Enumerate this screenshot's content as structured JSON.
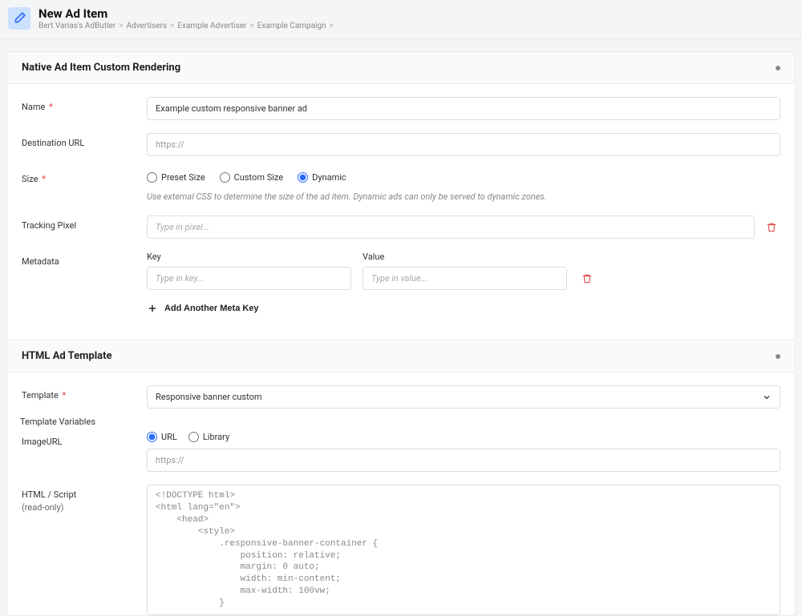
{
  "header": {
    "title": "New Ad Item",
    "breadcrumb": [
      "Bert Varias's AdButler",
      "Advertisers",
      "Example Advertiser",
      "Example Campaign"
    ]
  },
  "section_native": {
    "title": "Native Ad Item Custom Rendering",
    "fields": {
      "name": {
        "label": "Name",
        "value": "Example custom responsive banner ad"
      },
      "destination_url": {
        "label": "Destination URL",
        "placeholder": "https://"
      },
      "size": {
        "label": "Size",
        "options": {
          "preset": "Preset Size",
          "custom": "Custom Size",
          "dynamic": "Dynamic"
        },
        "selected": "dynamic",
        "hint": "Use external CSS to determine the size of the ad item. Dynamic ads can only be served to dynamic zones."
      },
      "tracking_pixel": {
        "label": "Tracking Pixel",
        "placeholder": "Type in pixel..."
      },
      "metadata": {
        "label": "Metadata",
        "key_label": "Key",
        "value_label": "Value",
        "key_placeholder": "Type in key...",
        "value_placeholder": "Type in value...",
        "add_btn": "Add Another Meta Key"
      }
    }
  },
  "section_template": {
    "title": "HTML Ad Template",
    "fields": {
      "template": {
        "label": "Template",
        "value": "Responsive banner custom"
      },
      "template_vars_label": "Template Variables",
      "image_url": {
        "label": "ImageURL",
        "options": {
          "url": "URL",
          "library": "Library"
        },
        "selected": "url",
        "placeholder": "https://"
      },
      "html_script": {
        "label": "HTML / Script",
        "readonly_note": "(read-only)",
        "code": "<!DOCTYPE html>\n<html lang=\"en\">\n    <head>\n        <style>\n            .responsive-banner-container {\n                position: relative;\n                margin: 0 auto;\n                width: min-content;\n                max-width: 100vw;\n            }"
      }
    }
  }
}
